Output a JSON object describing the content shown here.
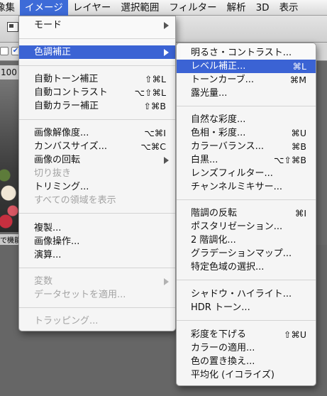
{
  "menubar": {
    "items": [
      "像集",
      "イメージ",
      "レイヤー",
      "選択範囲",
      "フィルター",
      "解析",
      "3D",
      "表示"
    ]
  },
  "canvas": {
    "zoom": "100",
    "status": "で機能"
  },
  "image_menu": {
    "mode": "モード",
    "adjustments": "色調補正",
    "auto_tone": {
      "label": "自動トーン補正",
      "shortcut": "⇧⌘L"
    },
    "auto_contrast": {
      "label": "自動コントラスト",
      "shortcut": "⌥⇧⌘L"
    },
    "auto_color": {
      "label": "自動カラー補正",
      "shortcut": "⇧⌘B"
    },
    "image_size": {
      "label": "画像解像度...",
      "shortcut": "⌥⌘I"
    },
    "canvas_size": {
      "label": "カンバスサイズ...",
      "shortcut": "⌥⌘C"
    },
    "rotation": "画像の回転",
    "crop": "切り抜き",
    "trim": "トリミング...",
    "reveal_all": "すべての領域を表示",
    "duplicate": "複製...",
    "apply_image": "画像操作...",
    "calculations": "演算...",
    "variables": "変数",
    "apply_dataset": "データセットを適用...",
    "trapping": "トラッピング..."
  },
  "adjust_menu": {
    "brightness_contrast": {
      "label": "明るさ・コントラスト...",
      "shortcut": ""
    },
    "levels": {
      "label": "レベル補正...",
      "shortcut": "⌘L"
    },
    "curves": {
      "label": "トーンカーブ...",
      "shortcut": "⌘M"
    },
    "exposure": {
      "label": "露光量...",
      "shortcut": ""
    },
    "vibrance": {
      "label": "自然な彩度...",
      "shortcut": ""
    },
    "hue_saturation": {
      "label": "色相・彩度...",
      "shortcut": "⌘U"
    },
    "color_balance": {
      "label": "カラーバランス...",
      "shortcut": "⌘B"
    },
    "black_white": {
      "label": "白黒...",
      "shortcut": "⌥⇧⌘B"
    },
    "photo_filter": {
      "label": "レンズフィルター...",
      "shortcut": ""
    },
    "channel_mixer": {
      "label": "チャンネルミキサー...",
      "shortcut": ""
    },
    "invert": {
      "label": "階調の反転",
      "shortcut": "⌘I"
    },
    "posterize": {
      "label": "ポスタリゼーション...",
      "shortcut": ""
    },
    "threshold": {
      "label": "2 階調化...",
      "shortcut": ""
    },
    "gradient_map": {
      "label": "グラデーションマップ...",
      "shortcut": ""
    },
    "selective_color": {
      "label": "特定色域の選択...",
      "shortcut": ""
    },
    "shadows_highlights": {
      "label": "シャドウ・ハイライト...",
      "shortcut": ""
    },
    "hdr_toning": {
      "label": "HDR トーン...",
      "shortcut": ""
    },
    "desaturate": {
      "label": "彩度を下げる",
      "shortcut": "⇧⌘U"
    },
    "match_color": {
      "label": "カラーの適用...",
      "shortcut": ""
    },
    "replace_color": {
      "label": "色の置き換え...",
      "shortcut": ""
    },
    "equalize": {
      "label": "平均化 (イコライズ)",
      "shortcut": ""
    }
  },
  "colors": {
    "selection": "#3b63d4",
    "disabled_text": "#a3a3a3"
  },
  "state": {
    "active_menu": "イメージ",
    "highlighted_item": "色調補正",
    "selected_submenu_item": "レベル補正..."
  }
}
